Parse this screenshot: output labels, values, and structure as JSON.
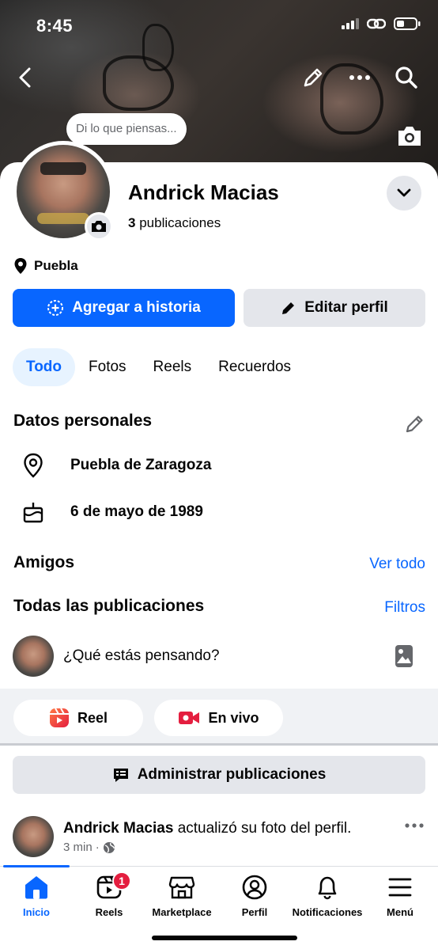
{
  "status_bar": {
    "time": "8:45"
  },
  "cover": {
    "bubble_text": "Di lo que piensas..."
  },
  "profile": {
    "name": "Andrick Macias",
    "posts_count": "3",
    "posts_label": "publicaciones",
    "location": "Puebla"
  },
  "actions": {
    "add_story": "Agregar a historia",
    "edit_profile": "Editar perfil"
  },
  "tabs": [
    "Todo",
    "Fotos",
    "Reels",
    "Recuerdos"
  ],
  "personal": {
    "title": "Datos personales",
    "city": "Puebla de Zaragoza",
    "birthday": "6 de mayo de 1989"
  },
  "friends": {
    "title": "Amigos",
    "see_all": "Ver todo"
  },
  "posts": {
    "title": "Todas las publicaciones",
    "filters": "Filtros",
    "composer_placeholder": "¿Qué estás pensando?",
    "reel": "Reel",
    "live": "En vivo",
    "manage": "Administrar publicaciones"
  },
  "post": {
    "author": "Andrick Macias",
    "action": "actualizó su foto del perfil.",
    "time": "3 min",
    "privacy_icon": "globe-icon"
  },
  "nav": {
    "items": [
      {
        "label": "Inicio",
        "icon": "home-icon"
      },
      {
        "label": "Reels",
        "icon": "reels-icon",
        "badge": "1"
      },
      {
        "label": "Marketplace",
        "icon": "marketplace-icon"
      },
      {
        "label": "Perfil",
        "icon": "profile-icon"
      },
      {
        "label": "Notificaciones",
        "icon": "bell-icon"
      },
      {
        "label": "Menú",
        "icon": "menu-icon"
      }
    ]
  },
  "colors": {
    "accent": "#0866ff",
    "badge": "#e41e3f",
    "grey_button": "#e4e6eb"
  }
}
